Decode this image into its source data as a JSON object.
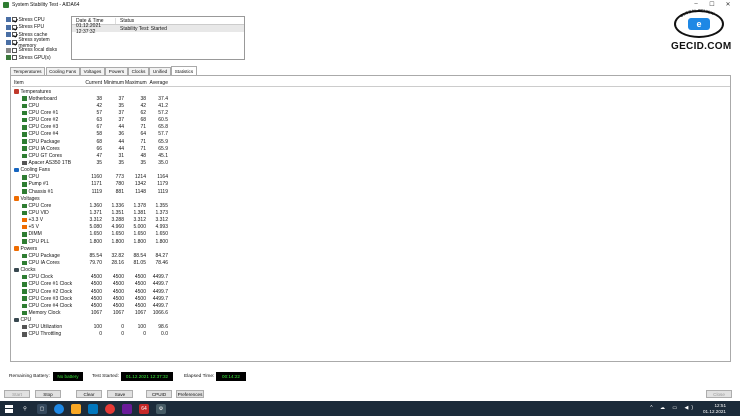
{
  "window": {
    "title": "System Stability Test - AIDA64",
    "controls": [
      "–",
      "☐",
      "✕"
    ]
  },
  "stress_options": [
    {
      "label": "Stress CPU",
      "checked": true
    },
    {
      "label": "Stress FPU",
      "checked": true
    },
    {
      "label": "Stress cache",
      "checked": true
    },
    {
      "label": "Stress system memory",
      "checked": true
    },
    {
      "label": "Stress local disks",
      "checked": false
    },
    {
      "label": "Stress GPU(s)",
      "checked": false
    }
  ],
  "status_log": {
    "headers": [
      "Date & Time",
      "Status"
    ],
    "rows": [
      [
        "01.12.2021 12:37:32",
        "Stability Test: Started"
      ]
    ]
  },
  "logo": {
    "ring_text": "GLOBAL REVIEW",
    "badge": "e",
    "word": "GECID.COM"
  },
  "tabs": [
    "Temperatures",
    "Cooling Fans",
    "Voltages",
    "Powers",
    "Clocks",
    "Unified",
    "Statistics"
  ],
  "active_tab": "Statistics",
  "stats_headers": [
    "Item",
    "Current",
    "Minimum",
    "Maximum",
    "Average"
  ],
  "stats_rows": [
    {
      "type": "group",
      "name": "Temperatures",
      "icon": "thermometer-icon",
      "color": "#c0392b"
    },
    {
      "type": "item",
      "name": "Motherboard",
      "icon": "motherboard-icon",
      "color": "#2e7d32",
      "v": [
        "38",
        "37",
        "38",
        "37.4"
      ]
    },
    {
      "type": "item",
      "name": "CPU",
      "icon": "cpu-icon",
      "color": "#2e7d32",
      "v": [
        "42",
        "35",
        "42",
        "41.2"
      ]
    },
    {
      "type": "item",
      "name": "CPU Core #1",
      "icon": "cpu-core-icon",
      "color": "#2e7d32",
      "v": [
        "57",
        "37",
        "62",
        "57.2"
      ]
    },
    {
      "type": "item",
      "name": "CPU Core #2",
      "icon": "cpu-core-icon",
      "color": "#2e7d32",
      "v": [
        "63",
        "37",
        "68",
        "60.5"
      ]
    },
    {
      "type": "item",
      "name": "CPU Core #3",
      "icon": "cpu-core-icon",
      "color": "#2e7d32",
      "v": [
        "67",
        "44",
        "71",
        "65.8"
      ]
    },
    {
      "type": "item",
      "name": "CPU Core #4",
      "icon": "cpu-core-icon",
      "color": "#2e7d32",
      "v": [
        "58",
        "36",
        "64",
        "57.7"
      ]
    },
    {
      "type": "item",
      "name": "CPU Package",
      "icon": "cpu-icon",
      "color": "#2e7d32",
      "v": [
        "68",
        "44",
        "71",
        "65.9"
      ]
    },
    {
      "type": "item",
      "name": "CPU IA Cores",
      "icon": "cpu-icon",
      "color": "#2e7d32",
      "v": [
        "66",
        "44",
        "71",
        "65.9"
      ]
    },
    {
      "type": "item",
      "name": "CPU GT Cores",
      "icon": "cpu-icon",
      "color": "#2e7d32",
      "v": [
        "47",
        "31",
        "48",
        "45.1"
      ]
    },
    {
      "type": "item",
      "name": "Apacer AS350 1TB",
      "icon": "disk-icon",
      "color": "#555555",
      "v": [
        "35",
        "35",
        "35",
        "35.0"
      ]
    },
    {
      "type": "group",
      "name": "Cooling Fans",
      "icon": "fan-icon",
      "color": "#1565c0"
    },
    {
      "type": "item",
      "name": "CPU",
      "icon": "cpu-icon",
      "color": "#2e7d32",
      "v": [
        "1160",
        "773",
        "1214",
        "1164"
      ]
    },
    {
      "type": "item",
      "name": "Pump #1",
      "icon": "pump-icon",
      "color": "#2e7d32",
      "v": [
        "1171",
        "780",
        "1342",
        "1179"
      ]
    },
    {
      "type": "item",
      "name": "Chassis #1",
      "icon": "chassis-icon",
      "color": "#2e7d32",
      "v": [
        "1119",
        "881",
        "1148",
        "1119"
      ]
    },
    {
      "type": "group",
      "name": "Voltages",
      "icon": "voltage-icon",
      "color": "#ef6c00"
    },
    {
      "type": "item",
      "name": "CPU Core",
      "icon": "cpu-icon",
      "color": "#2e7d32",
      "v": [
        "1.360",
        "1.336",
        "1.378",
        "1.355"
      ]
    },
    {
      "type": "item",
      "name": "CPU VID",
      "icon": "cpu-icon",
      "color": "#2e7d32",
      "v": [
        "1.371",
        "1.351",
        "1.381",
        "1.373"
      ]
    },
    {
      "type": "item",
      "name": "+3.3 V",
      "icon": "voltage-icon",
      "color": "#ef6c00",
      "v": [
        "3.312",
        "3.288",
        "3.312",
        "3.312"
      ]
    },
    {
      "type": "item",
      "name": "+5 V",
      "icon": "voltage-icon",
      "color": "#ef6c00",
      "v": [
        "5.080",
        "4.960",
        "5.000",
        "4.993"
      ]
    },
    {
      "type": "item",
      "name": "DIMM",
      "icon": "memory-icon",
      "color": "#2e7d32",
      "v": [
        "1.650",
        "1.650",
        "1.650",
        "1.650"
      ]
    },
    {
      "type": "item",
      "name": "CPU PLL",
      "icon": "cpu-icon",
      "color": "#2e7d32",
      "v": [
        "1.800",
        "1.800",
        "1.800",
        "1.800"
      ]
    },
    {
      "type": "group",
      "name": "Powers",
      "icon": "power-icon",
      "color": "#ef6c00"
    },
    {
      "type": "item",
      "name": "CPU Package",
      "icon": "cpu-icon",
      "color": "#2e7d32",
      "v": [
        "85.54",
        "32.82",
        "88.54",
        "84.27"
      ]
    },
    {
      "type": "item",
      "name": "CPU IA Cores",
      "icon": "cpu-icon",
      "color": "#2e7d32",
      "v": [
        "79.70",
        "28.16",
        "81.05",
        "78.46"
      ]
    },
    {
      "type": "group",
      "name": "Clocks",
      "icon": "clock-icon",
      "color": "#37474f"
    },
    {
      "type": "item",
      "name": "CPU Clock",
      "icon": "cpu-icon",
      "color": "#2e7d32",
      "v": [
        "4500",
        "4500",
        "4500",
        "4499.7"
      ]
    },
    {
      "type": "item",
      "name": "CPU Core #1 Clock",
      "icon": "cpu-core-icon",
      "color": "#2e7d32",
      "v": [
        "4500",
        "4500",
        "4500",
        "4499.7"
      ]
    },
    {
      "type": "item",
      "name": "CPU Core #2 Clock",
      "icon": "cpu-core-icon",
      "color": "#2e7d32",
      "v": [
        "4500",
        "4500",
        "4500",
        "4499.7"
      ]
    },
    {
      "type": "item",
      "name": "CPU Core #3 Clock",
      "icon": "cpu-core-icon",
      "color": "#2e7d32",
      "v": [
        "4500",
        "4500",
        "4500",
        "4499.7"
      ]
    },
    {
      "type": "item",
      "name": "CPU Core #4 Clock",
      "icon": "cpu-core-icon",
      "color": "#2e7d32",
      "v": [
        "4500",
        "4500",
        "4500",
        "4499.7"
      ]
    },
    {
      "type": "item",
      "name": "Memory Clock",
      "icon": "memory-icon",
      "color": "#2e7d32",
      "v": [
        "1067",
        "1067",
        "1067",
        "1066.6"
      ]
    },
    {
      "type": "group",
      "name": "CPU",
      "icon": "cpu-icon",
      "color": "#37474f"
    },
    {
      "type": "item",
      "name": "CPU Utilization",
      "icon": "cpu-util-icon",
      "color": "#555555",
      "v": [
        "100",
        "0",
        "100",
        "98.6"
      ]
    },
    {
      "type": "item",
      "name": "CPU Throttling",
      "icon": "cpu-throttle-icon",
      "color": "#555555",
      "v": [
        "0",
        "0",
        "0",
        "0.0"
      ]
    }
  ],
  "bottom_status": {
    "battery_label": "Remaining Battery:",
    "battery_value": "No battery",
    "started_label": "Test Started:",
    "started_value": "01.12.2021 12:37:32",
    "elapsed_label": "Elapsed Time:",
    "elapsed_value": "00:14:22"
  },
  "buttons": {
    "start": "Start",
    "stop": "Stop",
    "clear": "Clear",
    "save": "Save",
    "cpuid": "CPUID",
    "preferences": "Preferences",
    "close": "Close"
  },
  "taskbar": {
    "time": "12:51",
    "date": "01.12.2021",
    "tray": "^ ☁ ▭ ◀)"
  }
}
